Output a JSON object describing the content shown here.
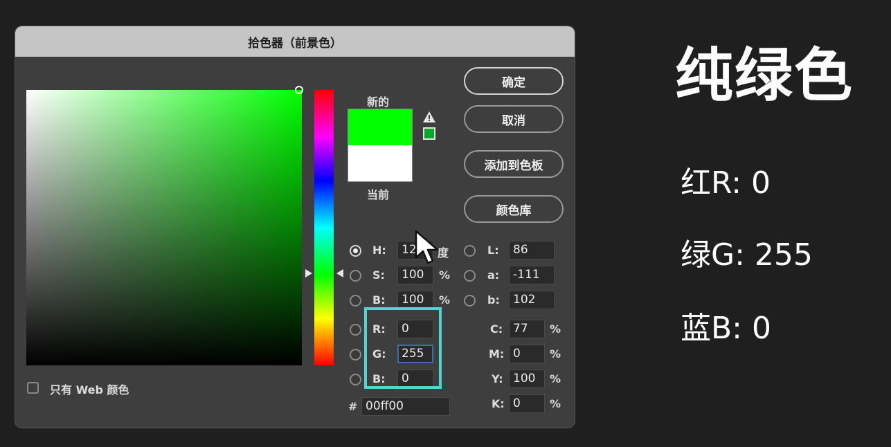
{
  "dialog": {
    "title": "拾色器（前景色）",
    "new_label": "新的",
    "current_label": "当前",
    "buttons": {
      "ok": "确定",
      "cancel": "取消",
      "add_to_swatches": "添加到色板",
      "color_libraries": "颜色库"
    },
    "web_only_label": "只有 Web 颜色",
    "hsb": {
      "h_label": "H:",
      "h_value": "120",
      "h_unit": "度",
      "s_label": "S:",
      "s_value": "100",
      "s_unit": "%",
      "b_label": "B:",
      "b_value": "100",
      "b_unit": "%"
    },
    "lab": {
      "l_label": "L:",
      "l_value": "86",
      "a_label": "a:",
      "a_value": "-111",
      "b_label": "b:",
      "b_value": "102"
    },
    "rgb": {
      "r_label": "R:",
      "r_value": "0",
      "g_label": "G:",
      "g_value": "255",
      "b_label": "B:",
      "b_value": "0"
    },
    "cmyk": {
      "c_label": "C:",
      "c_value": "77",
      "m_label": "M:",
      "m_value": "0",
      "y_label": "Y:",
      "y_value": "100",
      "k_label": "K:",
      "k_value": "0",
      "unit": "%"
    },
    "hex_label": "#",
    "hex_value": "00ff00",
    "colors": {
      "new": "#00ff00",
      "current": "#ffffff",
      "highlight": "#4fd6d2"
    }
  },
  "annotation": {
    "heading": "纯绿色",
    "red_line": "红R: 0",
    "green_line": "绿G: 255",
    "blue_line": "蓝B: 0"
  }
}
